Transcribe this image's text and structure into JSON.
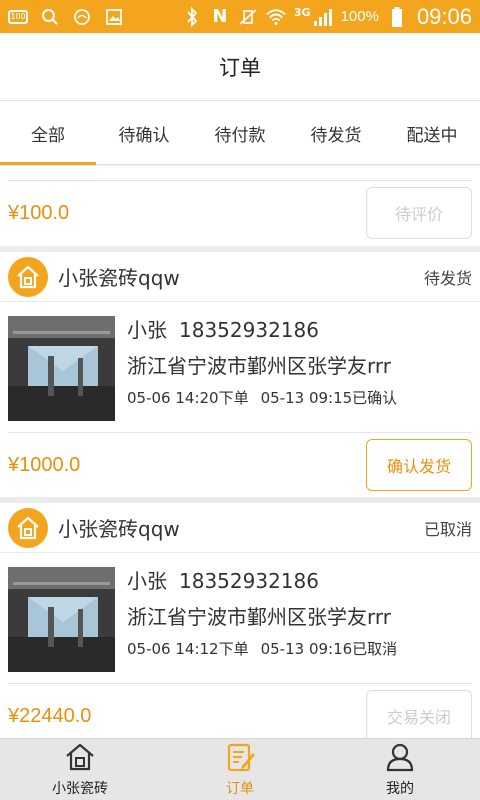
{
  "status_bar": {
    "battery_small": "100",
    "network": "3G",
    "battery_percent": "100%",
    "time": "09:06"
  },
  "header": {
    "title": "订单"
  },
  "tabs": [
    {
      "label": "全部",
      "active": true
    },
    {
      "label": "待确认",
      "active": false
    },
    {
      "label": "待付款",
      "active": false
    },
    {
      "label": "待发货",
      "active": false
    },
    {
      "label": "配送中",
      "active": false
    }
  ],
  "orders": [
    {
      "total": "¥100.0",
      "action_label": "待评价"
    },
    {
      "store_name": "小张瓷砖qqw",
      "status": "待发货",
      "buyer_name": "小张",
      "phone": "18352932186",
      "address": "浙江省宁波市鄞州区张学友rrr",
      "order_time": "05-06 14:20下单",
      "update_time": "05-13 09:15已确认",
      "total": "¥1000.0",
      "action_label": "确认发货"
    },
    {
      "store_name": "小张瓷砖qqw",
      "status": "已取消",
      "buyer_name": "小张",
      "phone": "18352932186",
      "address": "浙江省宁波市鄞州区张学友rrr",
      "order_time": "05-06 14:12下单",
      "update_time": "05-13 09:16已取消",
      "total": "¥22440.0",
      "action_label": "交易关闭"
    }
  ],
  "bottom_nav": [
    {
      "label": "小张瓷砖",
      "icon": "home-icon"
    },
    {
      "label": "订单",
      "icon": "orders-icon"
    },
    {
      "label": "我的",
      "icon": "profile-icon"
    }
  ],
  "colors": {
    "accent": "#f4a51e",
    "price": "#e8900c"
  }
}
